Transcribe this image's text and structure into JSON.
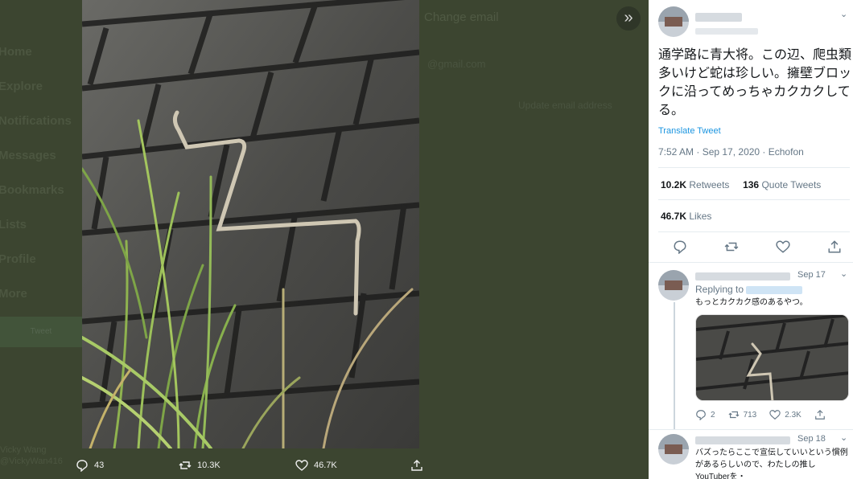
{
  "background": {
    "nav_items": [
      "Home",
      "Explore",
      "Notifications",
      "Messages",
      "Bookmarks",
      "Lists",
      "Profile",
      "More"
    ],
    "tweet_button": "Tweet",
    "user_name": "Vicky Wang",
    "user_handle": "@VickyWan416",
    "settings_title": "Change email",
    "settings_email": "@gmail.com",
    "settings_update": "Update email address"
  },
  "photo_actions": {
    "replies": "43",
    "retweets": "10.3K",
    "likes": "46.7K"
  },
  "tweet": {
    "text": "通学路に青大将。この辺、爬虫類多いけど蛇は珍しい。擁壁ブロックに沿ってめっちゃカクカクしてる。",
    "translate_label": "Translate Tweet",
    "meta": "7:52 AM · Sep 17, 2020 · Echofon",
    "retweets_count": "10.2K",
    "retweets_label": "Retweets",
    "quotes_count": "136",
    "quotes_label": "Quote Tweets",
    "likes_count": "46.7K",
    "likes_label": "Likes"
  },
  "replies": [
    {
      "date": "Sep 17",
      "replying_to": "Replying to",
      "text": "もっとカクカク感のあるやつ。",
      "replies": "2",
      "retweets": "713",
      "likes": "2.3K"
    },
    {
      "date": "Sep 18",
      "text": "バズったらここで宣伝していいという慣例があるらしいので、わたしの推しYouTuberを・"
    }
  ],
  "colors": {
    "backdrop": "#3c4530",
    "link": "#1b95e0",
    "muted": "#657786"
  },
  "icons": [
    "close-chevrons-icon",
    "reply-icon",
    "retweet-icon",
    "like-icon",
    "share-icon",
    "chevron-down-icon"
  ]
}
